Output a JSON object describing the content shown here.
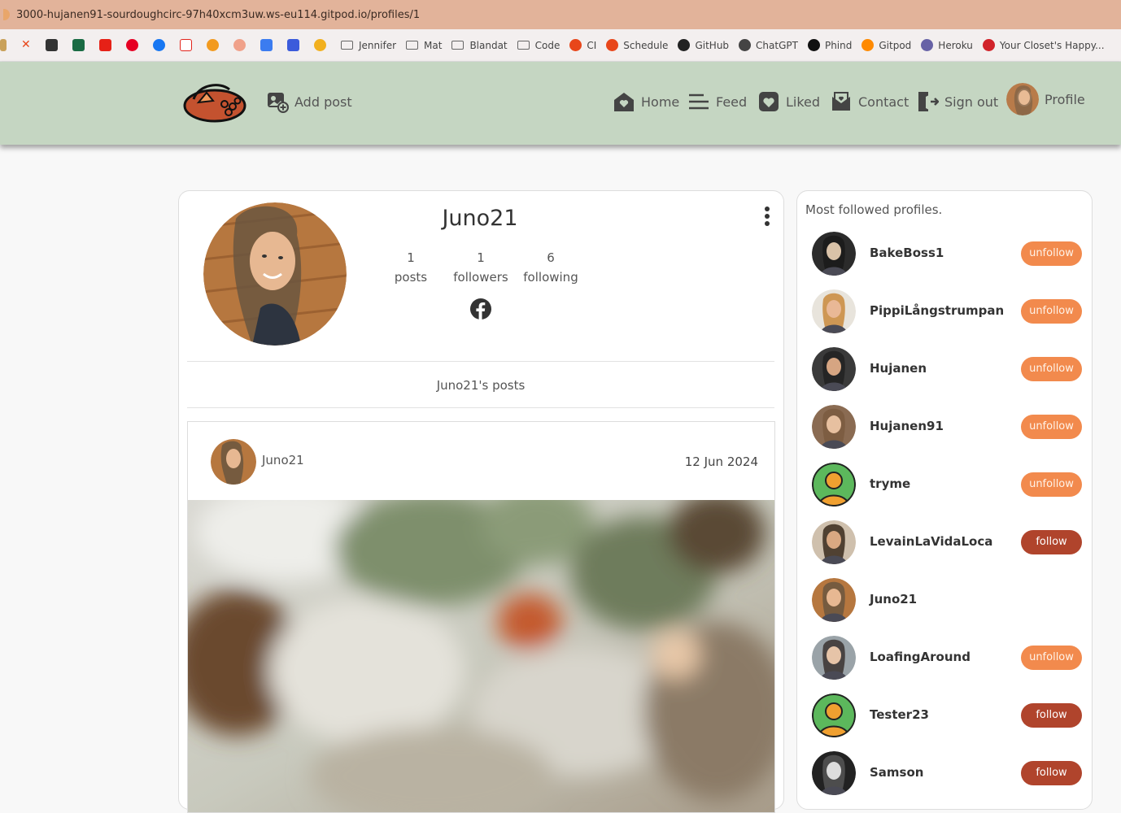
{
  "browser": {
    "url": "3000-hujanen91-sourdoughcirc-97h40xcm3uw.ws-eu114.gitpod.io/profiles/1",
    "bookmarks": [
      {
        "label": "Jennifer",
        "type": "folder"
      },
      {
        "label": "Mat",
        "type": "folder"
      },
      {
        "label": "Blandat",
        "type": "folder"
      },
      {
        "label": "Code",
        "type": "folder"
      },
      {
        "label": "CI",
        "type": "link",
        "color": "#e8461a"
      },
      {
        "label": "Schedule",
        "type": "link",
        "color": "#e8461a"
      },
      {
        "label": "GitHub",
        "type": "link",
        "color": "#222222"
      },
      {
        "label": "ChatGPT",
        "type": "link",
        "color": "#444444"
      },
      {
        "label": "Phind",
        "type": "link",
        "color": "#111111"
      },
      {
        "label": "Gitpod",
        "type": "link",
        "color": "#ff8a00"
      },
      {
        "label": "Heroku",
        "type": "link",
        "color": "#6762a6"
      },
      {
        "label": "Your Closet's Happy...",
        "type": "link",
        "color": "#d1232a"
      }
    ]
  },
  "nav": {
    "add_post": "Add post",
    "home": "Home",
    "feed": "Feed",
    "liked": "Liked",
    "contact": "Contact",
    "sign_out": "Sign out",
    "profile": "Profile"
  },
  "profile": {
    "name": "Juno21",
    "posts_count": "1",
    "posts_label": "posts",
    "followers_count": "1",
    "followers_label": "followers",
    "following_count": "6",
    "following_label": "following",
    "posts_heading": "Juno21's posts"
  },
  "post": {
    "owner": "Juno21",
    "date": "12 Jun 2024"
  },
  "sidebar": {
    "title": "Most followed profiles.",
    "profiles": [
      {
        "name": "BakeBoss1",
        "action": "unfollow"
      },
      {
        "name": "PippiLångstrumpan",
        "action": "unfollow"
      },
      {
        "name": "Hujanen",
        "action": "unfollow"
      },
      {
        "name": "Hujanen91",
        "action": "unfollow"
      },
      {
        "name": "tryme",
        "action": "unfollow"
      },
      {
        "name": "LevainLaVidaLoca",
        "action": "follow"
      },
      {
        "name": "Juno21",
        "action": ""
      },
      {
        "name": "LoafingAround",
        "action": "unfollow"
      },
      {
        "name": "Tester23",
        "action": "follow"
      },
      {
        "name": "Samson",
        "action": "follow"
      }
    ]
  },
  "colors": {
    "navbar": "#c5d6c2",
    "unfollow": "#f28a4d",
    "follow": "#b0442c",
    "brand": "#c4522f"
  }
}
